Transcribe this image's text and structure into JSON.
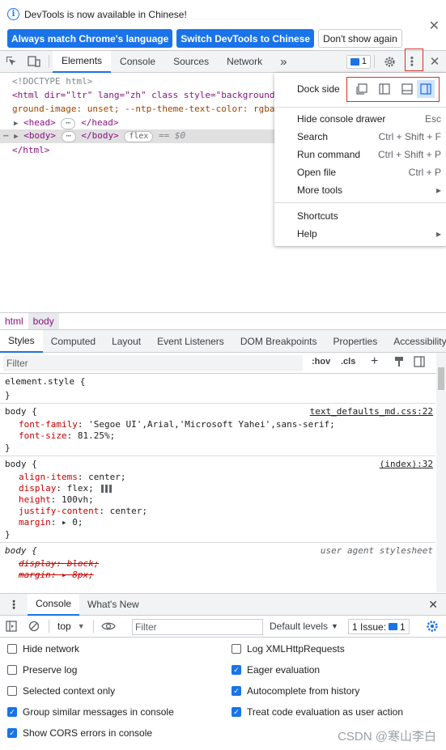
{
  "infobar": {
    "message": "DevTools is now available in Chinese!",
    "btn_match": "Always match Chrome's language",
    "btn_switch": "Switch DevTools to Chinese",
    "btn_dismiss": "Don't show again"
  },
  "toolbar": {
    "tabs": [
      "Elements",
      "Console",
      "Sources",
      "Network"
    ],
    "more": "»",
    "issues_count": "1"
  },
  "dom": {
    "doctype": "<!DOCTYPE html>",
    "html_open_1": "<html dir=\"ltr\" lang=\"zh\" class style=\"background",
    "html_open_2": "ground-image: unset; --ntp-theme-text-color: rgba",
    "head": "<head>",
    "head_close": "</head>",
    "body": "<body>",
    "body_close": "</body>",
    "flex_pill": "flex",
    "eq": "== $0",
    "html_close": "</html>"
  },
  "menu": {
    "dock_label": "Dock side",
    "items": [
      {
        "label": "Hide console drawer",
        "shortcut": "Esc"
      },
      {
        "label": "Search",
        "shortcut": "Ctrl + Shift + F"
      },
      {
        "label": "Run command",
        "shortcut": "Ctrl + Shift + P"
      },
      {
        "label": "Open file",
        "shortcut": "Ctrl + P"
      },
      {
        "label": "More tools",
        "shortcut": "▸"
      },
      {
        "label": "Shortcuts",
        "shortcut": ""
      },
      {
        "label": "Help",
        "shortcut": "▸"
      }
    ]
  },
  "breadcrumbs": [
    "html",
    "body"
  ],
  "style_tabs": [
    "Styles",
    "Computed",
    "Layout",
    "Event Listeners",
    "DOM Breakpoints",
    "Properties",
    "Accessibility"
  ],
  "styles_filter": {
    "placeholder": "Filter",
    "hov": ":hov",
    "cls": ".cls"
  },
  "rules": {
    "r1_sel": "element.style {",
    "close": "}",
    "r2_sel": "body {",
    "r2_src": "text_defaults_md.css:22",
    "r2_p1_name": "font-family",
    "r2_p1_val": ": 'Segoe UI',Arial,'Microsoft Yahei',sans-serif;",
    "r2_p2_name": "font-size",
    "r2_p2_val": ": 81.25%;",
    "r3_sel": "body {",
    "r3_src": "(index):32",
    "r3_p1_name": "align-items",
    "r3_p1_val": ": center;",
    "r3_p2_name": "display",
    "r3_p2_val": ": flex;",
    "r3_p3_name": "height",
    "r3_p3_val": ": 100vh;",
    "r3_p4_name": "justify-content",
    "r3_p4_val": ": center;",
    "r3_p5_name": "margin",
    "r3_p5_val": ": ▸ 0;",
    "r4_sel": "body {",
    "r4_src": "user agent stylesheet",
    "r4_p1": "display: block;",
    "r4_p2": "margin: ▸ 8px;"
  },
  "drawer": {
    "tabs": [
      "Console",
      "What's New"
    ],
    "context": "top",
    "filter_placeholder": "Filter",
    "levels": "Default levels",
    "issues_label": "1 Issue:",
    "issues_count": "1"
  },
  "console_settings": [
    {
      "label": "Hide network",
      "checked": false
    },
    {
      "label": "Log XMLHttpRequests",
      "checked": false
    },
    {
      "label": "Preserve log",
      "checked": false
    },
    {
      "label": "Eager evaluation",
      "checked": true
    },
    {
      "label": "Selected context only",
      "checked": false
    },
    {
      "label": "Autocomplete from history",
      "checked": true
    },
    {
      "label": "Group similar messages in console",
      "checked": true
    },
    {
      "label": "Treat code evaluation as user action",
      "checked": true
    },
    {
      "label": "Show CORS errors in console",
      "checked": true
    }
  ],
  "watermark": "CSDN @寒山李白",
  "colors": {
    "accent": "#1a73e8",
    "tag": "#881280",
    "prop": "#c80000",
    "highlight": "#d93025"
  }
}
